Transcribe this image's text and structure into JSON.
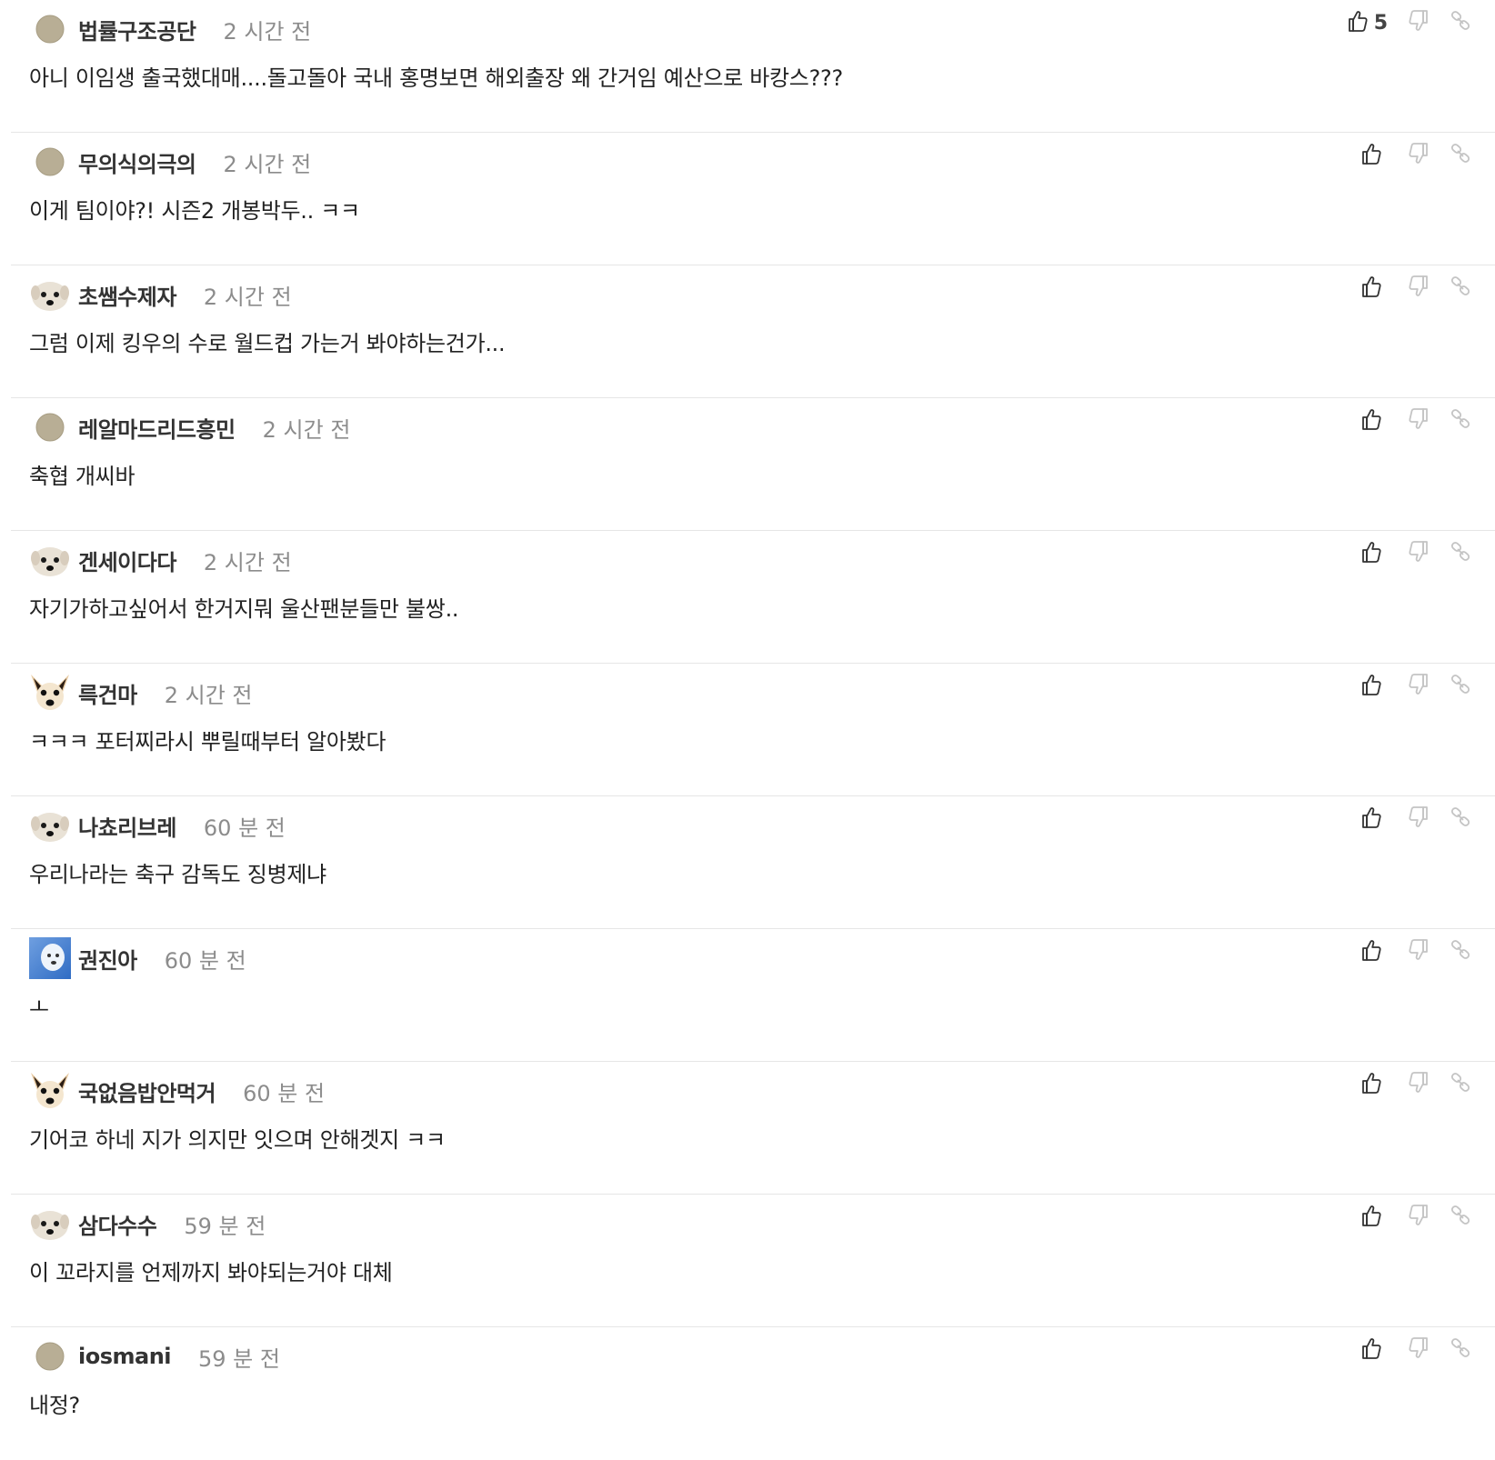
{
  "comments": [
    {
      "nickname": "법률구조공단",
      "time": "2 시간 전",
      "text": "아니 이임생 출국했대매....돌고돌아 국내 홍명보면 해외출장 왜 간거임 예산으로 바캉스???",
      "likes": "5",
      "avatar": "default-avatar"
    },
    {
      "nickname": "무의식의극의",
      "time": "2 시간 전",
      "text": "이게 팀이야?! 시즌2 개봉박두.. ㅋㅋ",
      "likes": "",
      "avatar": "default-avatar"
    },
    {
      "nickname": "초쌤수제자",
      "time": "2 시간 전",
      "text": "그럼 이제 킹우의 수로 월드컵 가는거 봐야하는건가...",
      "likes": "",
      "avatar": "puppy-avatar"
    },
    {
      "nickname": "레알마드리드흥민",
      "time": "2 시간 전",
      "text": "축협 개씨바",
      "likes": "",
      "avatar": "default-avatar"
    },
    {
      "nickname": "겐세이다다",
      "time": "2 시간 전",
      "text": "자기가하고싶어서 한거지뭐 울산팬분들만 불쌍..",
      "likes": "",
      "avatar": "puppy-avatar"
    },
    {
      "nickname": "륵건마",
      "time": "2 시간 전",
      "text": "ㅋㅋㅋ 포터찌라시 뿌릴때부터 알아봤다",
      "likes": "",
      "avatar": "chihuahua-avatar"
    },
    {
      "nickname": "나쵸리브레",
      "time": "60 분 전",
      "text": "우리나라는 축구 감독도 징병제냐",
      "likes": "",
      "avatar": "puppy-avatar"
    },
    {
      "nickname": "권진아",
      "time": "60 분 전",
      "text": "ㅗ",
      "likes": "",
      "avatar": "photo-avatar"
    },
    {
      "nickname": "국없음밥안먹거",
      "time": "60 분 전",
      "text": "기어코 하네 지가 의지만 잇으며 안해겟지 ㅋㅋ",
      "likes": "",
      "avatar": "chihuahua-avatar"
    },
    {
      "nickname": "삼다수수",
      "time": "59 분 전",
      "text": "이 꼬라지를 언제까지 봐야되는거야 대체",
      "likes": "",
      "avatar": "puppy-avatar"
    },
    {
      "nickname": "iosmani",
      "time": "59 분 전",
      "text": "내정?",
      "likes": "",
      "avatar": "default-avatar"
    }
  ],
  "icons": {
    "like": "thumbs-up-icon",
    "dislike": "thumbs-down-icon",
    "share": "link-icon"
  },
  "colors": {
    "nickname": "#333333",
    "time": "#8c8c8c",
    "divider": "#e6e6e6",
    "default_avatar": "#b8ae95"
  }
}
